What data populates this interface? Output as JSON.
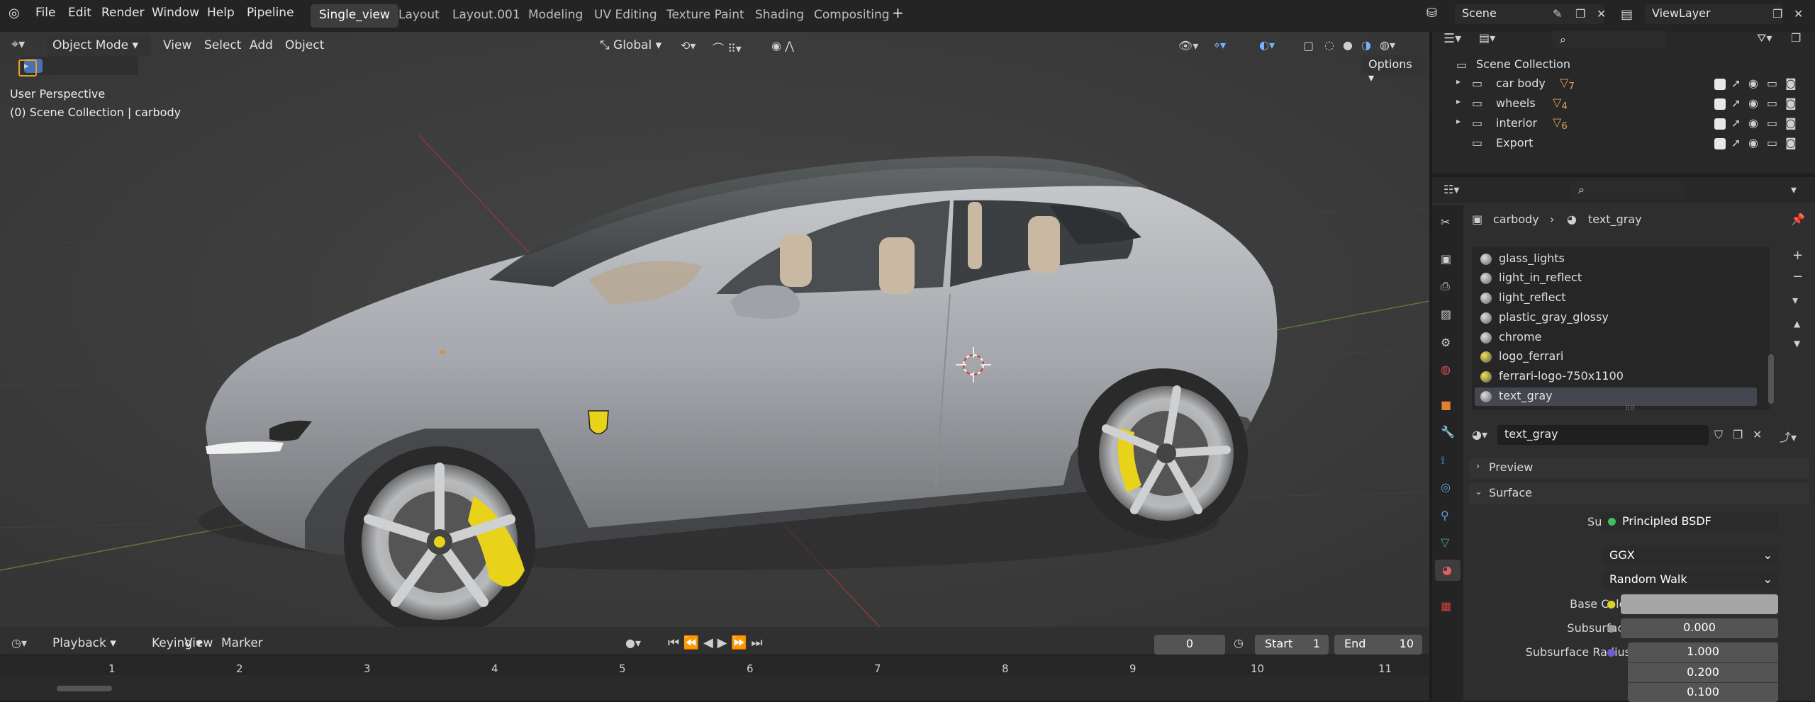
{
  "menu": [
    "File",
    "Edit",
    "Render",
    "Window",
    "Help",
    "Pipeline"
  ],
  "workspaces": [
    "Single_view",
    "Layout",
    "Layout.001",
    "Modeling",
    "UV Editing",
    "Texture Paint",
    "Shading",
    "Compositing"
  ],
  "scene": {
    "label": "Scene",
    "viewlayer": "ViewLayer"
  },
  "viewport_header": {
    "mode": "Object Mode",
    "view": "View",
    "select": "Select",
    "add": "Add",
    "object": "Object",
    "orientation": "Global",
    "options": "Options"
  },
  "viewport_info": {
    "line1": "User Perspective",
    "line2": "(0) Scene Collection | carbody"
  },
  "outliner": {
    "root": "Scene Collection",
    "items": [
      {
        "name": "car body",
        "count": "7"
      },
      {
        "name": "wheels",
        "count": "4"
      },
      {
        "name": "interior",
        "count": "6"
      },
      {
        "name": "Export",
        "count": ""
      }
    ]
  },
  "properties": {
    "breadcrumb_object": "carbody",
    "breadcrumb_material": "text_gray",
    "materials": [
      "glass_lights",
      "light_in_reflect",
      "light_reflect",
      "plastic_gray_glossy",
      "chrome",
      "logo_ferrari",
      "ferrari-logo-750x1100",
      "text_gray"
    ],
    "selected_material": "text_gray",
    "material_name": "text_gray",
    "preview": "Preview",
    "surface_panel": "Surface",
    "surface_label": "Surface",
    "surface_value": "Principled BSDF",
    "distribution": "GGX",
    "subsurface_method": "Random Walk",
    "base_color_label": "Base Color",
    "subsurface_label": "Subsurface",
    "subsurface_value": "0.000",
    "subsurface_radius_label": "Subsurface Radius",
    "radius": [
      "1.000",
      "0.200",
      "0.100"
    ]
  },
  "timeline": {
    "playback": "Playback",
    "keying": "Keying",
    "view": "View",
    "marker": "Marker",
    "current_frame": "0",
    "start_label": "Start",
    "start": "1",
    "end_label": "End",
    "end": "10",
    "frames": [
      "1",
      "2",
      "3",
      "4",
      "5",
      "6",
      "7",
      "8",
      "9",
      "10",
      "11"
    ]
  },
  "colors": {
    "accent": "#4772b3",
    "active_tab": "#3d3d3d",
    "caliper": "#e8d21a"
  }
}
